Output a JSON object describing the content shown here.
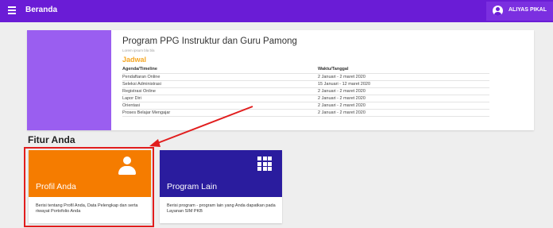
{
  "topbar": {
    "title": "Beranda",
    "user_name": "ALIYAS PIKAL"
  },
  "program": {
    "title": "Program PPG Instruktur dan Guru Pamong",
    "subtitle": "Lorem ipsum bla bla",
    "jadwal_label": "Jadwal",
    "columns": [
      "Agenda/Timeline",
      "Waktu/Tanggal"
    ],
    "rows": [
      [
        "Pendaftaran Online",
        "2 Januari - 2 maret 2020"
      ],
      [
        "Seleksi Administrasi",
        "15 Januari - 12 maret 2020"
      ],
      [
        "Registrasi Online",
        "2 Januari - 2 maret 2020"
      ],
      [
        "Lapor Diri",
        "2 Januari - 2 maret 2020"
      ],
      [
        "Orientasi",
        "2 Januari - 2 maret 2020"
      ],
      [
        "Proses Belajar Mengajar",
        "2 Januari - 2 maret 2020"
      ]
    ]
  },
  "fitur": {
    "title": "Fitur Anda",
    "cards": [
      {
        "label": "Profil Anda",
        "icon": "person-icon",
        "color": "#f57c00",
        "description": "Berisi tentang Profil Anda, Data Pelengkap dan serta riwayat Portofolio Anda"
      },
      {
        "label": "Program Lain",
        "icon": "grid-icon",
        "color": "#2a1c9e",
        "description": "Berisi program - program lain yang Anda dapatkan pada Layanan SIM PKB"
      }
    ]
  },
  "colors": {
    "topbar": "#6a1cd6",
    "accent": "#f5a623",
    "highlight": "#e11d1d"
  }
}
